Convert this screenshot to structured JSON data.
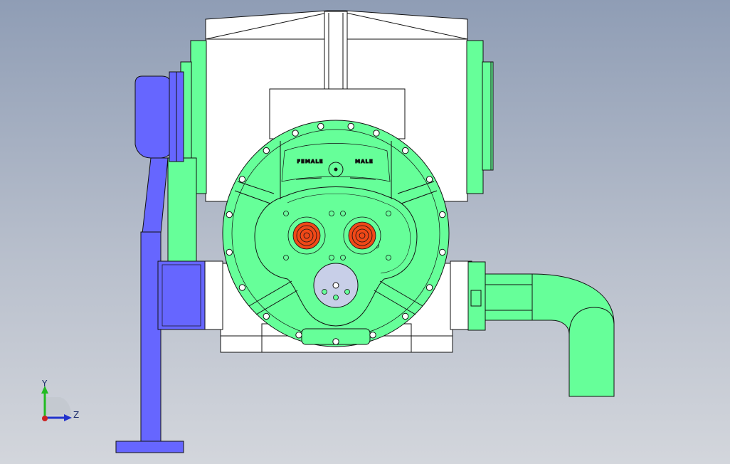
{
  "viewport": {
    "background_top": "#8f9db5",
    "background_bottom": "#d3d6dc"
  },
  "model": {
    "colors": {
      "housing": "#ffffff",
      "body": "#66ff99",
      "motor": "#6666ff",
      "rotor_face": "#f04818",
      "shaft_disk": "#c8cfe8",
      "edge": "#111111"
    },
    "labels": {
      "female": "FEMALE",
      "male": "MALE"
    }
  },
  "triad": {
    "y_label": "Y",
    "z_label": "Z",
    "colors": {
      "y": "#22bb22",
      "z": "#2233cc",
      "x": "#cc2222"
    }
  }
}
